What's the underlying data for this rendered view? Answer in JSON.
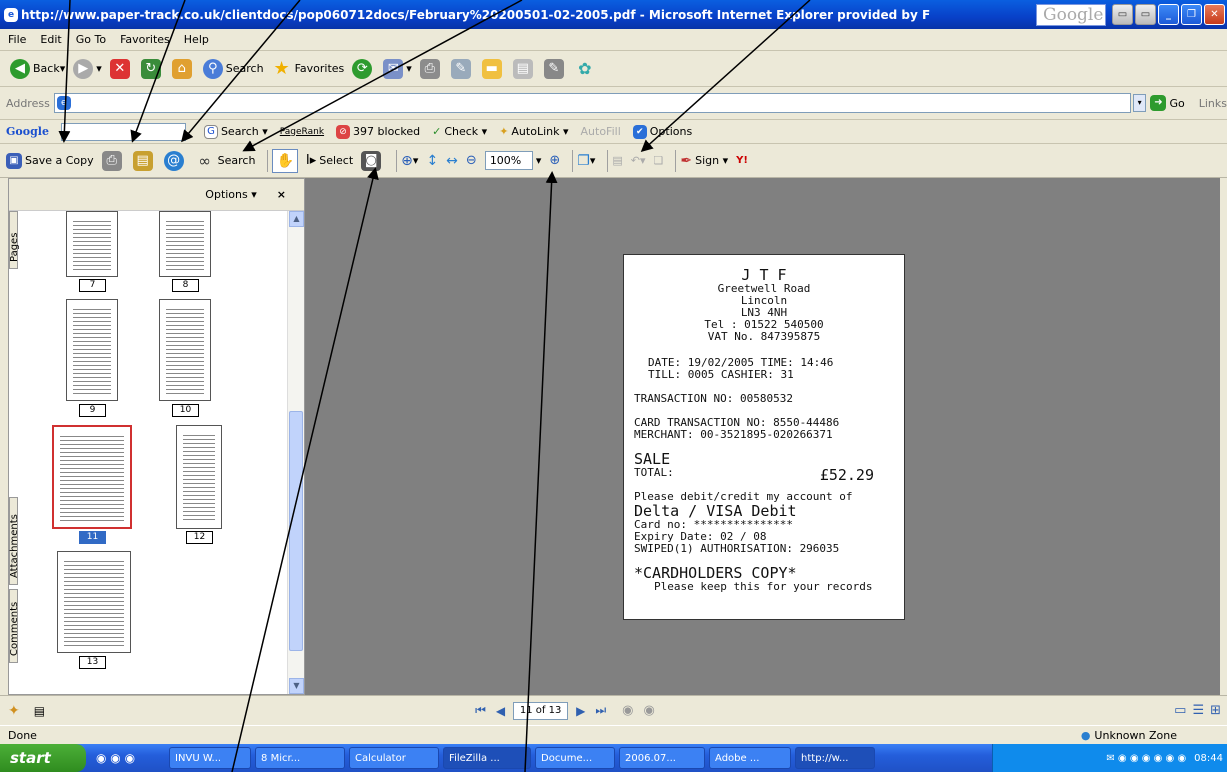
{
  "window": {
    "title": "http://www.paper-track.co.uk/clientdocs/pop060712docs/February%20200501-02-2005.pdf - Microsoft Internet Explorer provided by F",
    "google_box": "Google"
  },
  "menu": [
    "File",
    "Edit",
    "Go To",
    "Favorites",
    "Help"
  ],
  "std_toolbar": {
    "back": "Back",
    "search": "Search",
    "favorites": "Favorites"
  },
  "address": {
    "label": "Address",
    "go": "Go",
    "links": "Links"
  },
  "google_toolbar": {
    "logo": "Google",
    "search": "Search",
    "pagerank": "PageRank",
    "blocked": "397 blocked",
    "check": "Check",
    "autolink": "AutoLink",
    "autofill": "AutoFill",
    "options": "Options"
  },
  "acrobat_toolbar": {
    "save_copy": "Save a Copy",
    "search": "Search",
    "select": "Select",
    "zoom": "100%",
    "sign": "Sign"
  },
  "nav_panel": {
    "options": "Options",
    "close": "×",
    "tabs": [
      "Pages",
      "Attachments",
      "Comments"
    ],
    "pages": [
      "7",
      "8",
      "9",
      "10",
      "11",
      "12",
      "13"
    ]
  },
  "receipt": {
    "lines": [
      "J T F",
      "Greetwell Road",
      "Lincoln",
      "LN3 4NH",
      "Tel : 01522 540500",
      "VAT No. 847395875"
    ],
    "date_line": "DATE: 19/02/2005 TIME: 14:46",
    "till_line": "TILL: 0005    CASHIER: 31",
    "transaction": "TRANSACTION NO: 00580532",
    "card_txn": "CARD TRANSACTION NO: 8550-44486",
    "merchant": "MERCHANT: 00-3521895-020266371",
    "sale": "SALE",
    "total_label": "TOTAL:",
    "total_value": "£52.29",
    "debit_line": "Please debit/credit my account of",
    "card_type": "Delta / VISA Debit",
    "card_no": "Card no: ***************",
    "expiry": "Expiry Date: 02 / 08",
    "swiped": "SWIPED(1) AUTHORISATION: 296035",
    "copy": "*CARDHOLDERS COPY*",
    "keep": "Please keep this for your records"
  },
  "doc_nav": {
    "page": "11 of 13"
  },
  "status": {
    "left": "Done",
    "zone": "Unknown Zone"
  },
  "taskbar": {
    "start": "start",
    "tasks": [
      "INVU W...",
      "8 Micr...",
      "Calculator",
      "FileZilla ...",
      "Docume...",
      "2006.07...",
      "Adobe ...",
      "http://w..."
    ],
    "clock": "08:44"
  }
}
